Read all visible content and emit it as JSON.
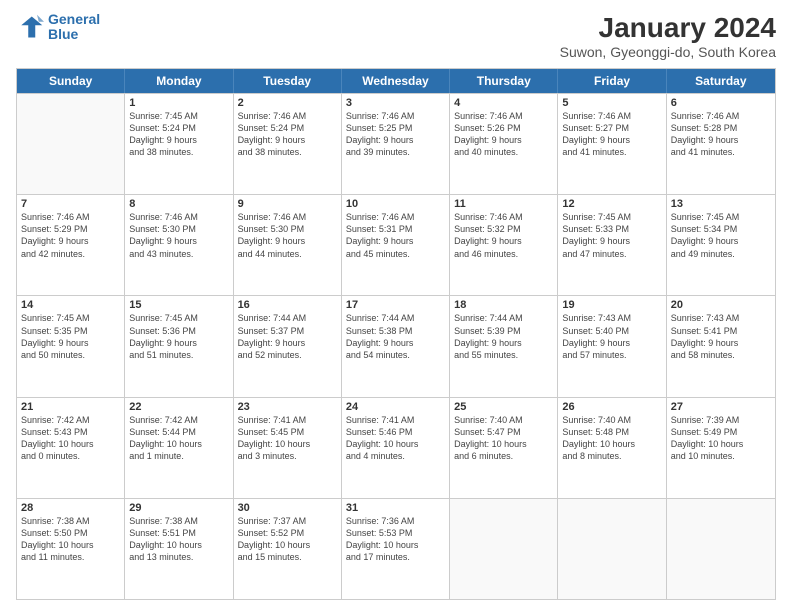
{
  "logo": {
    "line1": "General",
    "line2": "Blue"
  },
  "title": "January 2024",
  "subtitle": "Suwon, Gyeonggi-do, South Korea",
  "weekdays": [
    "Sunday",
    "Monday",
    "Tuesday",
    "Wednesday",
    "Thursday",
    "Friday",
    "Saturday"
  ],
  "weeks": [
    [
      {
        "day": "",
        "lines": []
      },
      {
        "day": "1",
        "lines": [
          "Sunrise: 7:45 AM",
          "Sunset: 5:24 PM",
          "Daylight: 9 hours",
          "and 38 minutes."
        ]
      },
      {
        "day": "2",
        "lines": [
          "Sunrise: 7:46 AM",
          "Sunset: 5:24 PM",
          "Daylight: 9 hours",
          "and 38 minutes."
        ]
      },
      {
        "day": "3",
        "lines": [
          "Sunrise: 7:46 AM",
          "Sunset: 5:25 PM",
          "Daylight: 9 hours",
          "and 39 minutes."
        ]
      },
      {
        "day": "4",
        "lines": [
          "Sunrise: 7:46 AM",
          "Sunset: 5:26 PM",
          "Daylight: 9 hours",
          "and 40 minutes."
        ]
      },
      {
        "day": "5",
        "lines": [
          "Sunrise: 7:46 AM",
          "Sunset: 5:27 PM",
          "Daylight: 9 hours",
          "and 41 minutes."
        ]
      },
      {
        "day": "6",
        "lines": [
          "Sunrise: 7:46 AM",
          "Sunset: 5:28 PM",
          "Daylight: 9 hours",
          "and 41 minutes."
        ]
      }
    ],
    [
      {
        "day": "7",
        "lines": [
          "Sunrise: 7:46 AM",
          "Sunset: 5:29 PM",
          "Daylight: 9 hours",
          "and 42 minutes."
        ]
      },
      {
        "day": "8",
        "lines": [
          "Sunrise: 7:46 AM",
          "Sunset: 5:30 PM",
          "Daylight: 9 hours",
          "and 43 minutes."
        ]
      },
      {
        "day": "9",
        "lines": [
          "Sunrise: 7:46 AM",
          "Sunset: 5:30 PM",
          "Daylight: 9 hours",
          "and 44 minutes."
        ]
      },
      {
        "day": "10",
        "lines": [
          "Sunrise: 7:46 AM",
          "Sunset: 5:31 PM",
          "Daylight: 9 hours",
          "and 45 minutes."
        ]
      },
      {
        "day": "11",
        "lines": [
          "Sunrise: 7:46 AM",
          "Sunset: 5:32 PM",
          "Daylight: 9 hours",
          "and 46 minutes."
        ]
      },
      {
        "day": "12",
        "lines": [
          "Sunrise: 7:45 AM",
          "Sunset: 5:33 PM",
          "Daylight: 9 hours",
          "and 47 minutes."
        ]
      },
      {
        "day": "13",
        "lines": [
          "Sunrise: 7:45 AM",
          "Sunset: 5:34 PM",
          "Daylight: 9 hours",
          "and 49 minutes."
        ]
      }
    ],
    [
      {
        "day": "14",
        "lines": [
          "Sunrise: 7:45 AM",
          "Sunset: 5:35 PM",
          "Daylight: 9 hours",
          "and 50 minutes."
        ]
      },
      {
        "day": "15",
        "lines": [
          "Sunrise: 7:45 AM",
          "Sunset: 5:36 PM",
          "Daylight: 9 hours",
          "and 51 minutes."
        ]
      },
      {
        "day": "16",
        "lines": [
          "Sunrise: 7:44 AM",
          "Sunset: 5:37 PM",
          "Daylight: 9 hours",
          "and 52 minutes."
        ]
      },
      {
        "day": "17",
        "lines": [
          "Sunrise: 7:44 AM",
          "Sunset: 5:38 PM",
          "Daylight: 9 hours",
          "and 54 minutes."
        ]
      },
      {
        "day": "18",
        "lines": [
          "Sunrise: 7:44 AM",
          "Sunset: 5:39 PM",
          "Daylight: 9 hours",
          "and 55 minutes."
        ]
      },
      {
        "day": "19",
        "lines": [
          "Sunrise: 7:43 AM",
          "Sunset: 5:40 PM",
          "Daylight: 9 hours",
          "and 57 minutes."
        ]
      },
      {
        "day": "20",
        "lines": [
          "Sunrise: 7:43 AM",
          "Sunset: 5:41 PM",
          "Daylight: 9 hours",
          "and 58 minutes."
        ]
      }
    ],
    [
      {
        "day": "21",
        "lines": [
          "Sunrise: 7:42 AM",
          "Sunset: 5:43 PM",
          "Daylight: 10 hours",
          "and 0 minutes."
        ]
      },
      {
        "day": "22",
        "lines": [
          "Sunrise: 7:42 AM",
          "Sunset: 5:44 PM",
          "Daylight: 10 hours",
          "and 1 minute."
        ]
      },
      {
        "day": "23",
        "lines": [
          "Sunrise: 7:41 AM",
          "Sunset: 5:45 PM",
          "Daylight: 10 hours",
          "and 3 minutes."
        ]
      },
      {
        "day": "24",
        "lines": [
          "Sunrise: 7:41 AM",
          "Sunset: 5:46 PM",
          "Daylight: 10 hours",
          "and 4 minutes."
        ]
      },
      {
        "day": "25",
        "lines": [
          "Sunrise: 7:40 AM",
          "Sunset: 5:47 PM",
          "Daylight: 10 hours",
          "and 6 minutes."
        ]
      },
      {
        "day": "26",
        "lines": [
          "Sunrise: 7:40 AM",
          "Sunset: 5:48 PM",
          "Daylight: 10 hours",
          "and 8 minutes."
        ]
      },
      {
        "day": "27",
        "lines": [
          "Sunrise: 7:39 AM",
          "Sunset: 5:49 PM",
          "Daylight: 10 hours",
          "and 10 minutes."
        ]
      }
    ],
    [
      {
        "day": "28",
        "lines": [
          "Sunrise: 7:38 AM",
          "Sunset: 5:50 PM",
          "Daylight: 10 hours",
          "and 11 minutes."
        ]
      },
      {
        "day": "29",
        "lines": [
          "Sunrise: 7:38 AM",
          "Sunset: 5:51 PM",
          "Daylight: 10 hours",
          "and 13 minutes."
        ]
      },
      {
        "day": "30",
        "lines": [
          "Sunrise: 7:37 AM",
          "Sunset: 5:52 PM",
          "Daylight: 10 hours",
          "and 15 minutes."
        ]
      },
      {
        "day": "31",
        "lines": [
          "Sunrise: 7:36 AM",
          "Sunset: 5:53 PM",
          "Daylight: 10 hours",
          "and 17 minutes."
        ]
      },
      {
        "day": "",
        "lines": []
      },
      {
        "day": "",
        "lines": []
      },
      {
        "day": "",
        "lines": []
      }
    ]
  ]
}
